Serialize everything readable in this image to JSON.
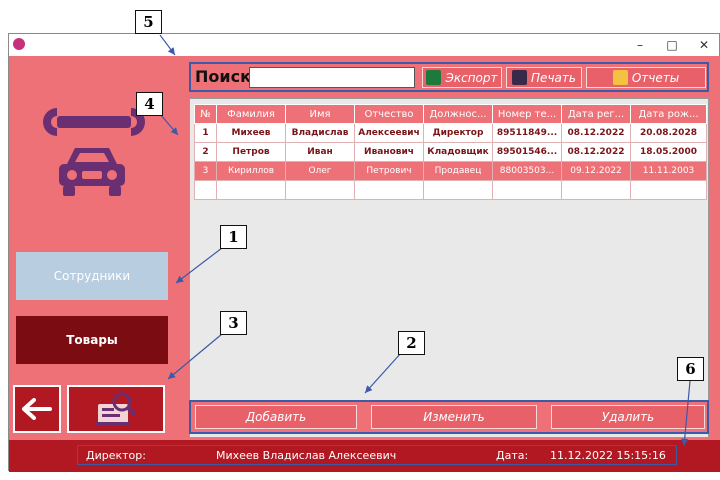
{
  "window": {
    "minimize_glyph": "–",
    "maximize_glyph": "□",
    "close_glyph": "✕"
  },
  "callouts": [
    "1",
    "2",
    "3",
    "4",
    "5",
    "6"
  ],
  "search": {
    "label": "Поиск",
    "value": "",
    "placeholder": ""
  },
  "toolbar": {
    "export_label": "Экспорт",
    "print_label": "Печать",
    "reports_label": "Отчеты"
  },
  "table": {
    "columns": [
      "№",
      "Фамилия",
      "Имя",
      "Отчество",
      "Должнос...",
      "Номер те...",
      "Дата рег...",
      "Дата рож..."
    ],
    "rows": [
      [
        "1",
        "Михеев",
        "Владислав",
        "Алексеевич",
        "Директор",
        "89511849...",
        "08.12.2022",
        "20.08.2028"
      ],
      [
        "2",
        "Петров",
        "Иван",
        "Иванович",
        "Кладовщик",
        "89501546...",
        "08.12.2022",
        "18.05.2000"
      ],
      [
        "3",
        "Кириллов",
        "Олег",
        "Петрович",
        "Продавец",
        "88003503...",
        "09.12.2022",
        "11.11.2003"
      ]
    ],
    "selected_row": 3
  },
  "sidebar": {
    "employees_label": "Сотрудники",
    "goods_label": "Товары"
  },
  "actions": {
    "add_label": "Добавить",
    "edit_label": "Изменить",
    "delete_label": "Удалить"
  },
  "status": {
    "role_label": "Директор:",
    "user_name": "Михеев Владислав Алексеевич",
    "date_label": "Дата:",
    "datetime": "11.12.2022 15:15:16"
  },
  "colors": {
    "panel": "#ee7177",
    "dark_red": "#b21821",
    "maroon_button": "#7b0c12",
    "disabled_button": "#b8cde0",
    "callout_border": "#3b5aa8",
    "icon_purple": "#6a2f73"
  },
  "icons": [
    "wrench-icon",
    "car-icon",
    "excel-icon",
    "printer-icon",
    "report-icon",
    "back-arrow-icon",
    "reference-book-icon"
  ]
}
